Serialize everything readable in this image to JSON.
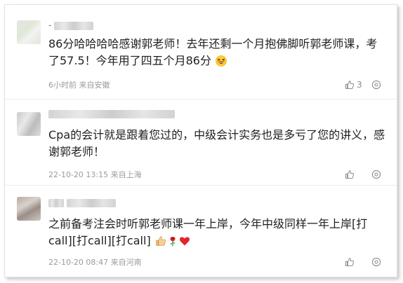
{
  "comments": [
    {
      "prefix": "-",
      "text": "86分哈哈哈哈感谢郭老师！去年还剩一个月抱佛脚听郭老师课，考了57.5！今年用了四五个月86分",
      "emoji": [
        "grinning-squint-face"
      ],
      "time": "6小时前 来自安徽",
      "likes": "3"
    },
    {
      "prefix": "",
      "text": "Cpa的会计就是跟着您过的，中级会计实务也是多亏了您的讲义，感谢郭老师！",
      "emoji": [],
      "time": "22-10-20 13:15 来自上海",
      "likes": ""
    },
    {
      "prefix": "",
      "text": "之前备考注会时听郭老师课一年上岸，今年中级同样一年上岸[打call][打call][打call]",
      "emoji": [
        "thumbs-up",
        "rose",
        "red-heart"
      ],
      "time": "22-10-20 08:47 来自河南",
      "likes": ""
    }
  ],
  "colors": {
    "text": "#1f1f1f",
    "meta": "#9b9b9b",
    "divider": "#ececec"
  }
}
